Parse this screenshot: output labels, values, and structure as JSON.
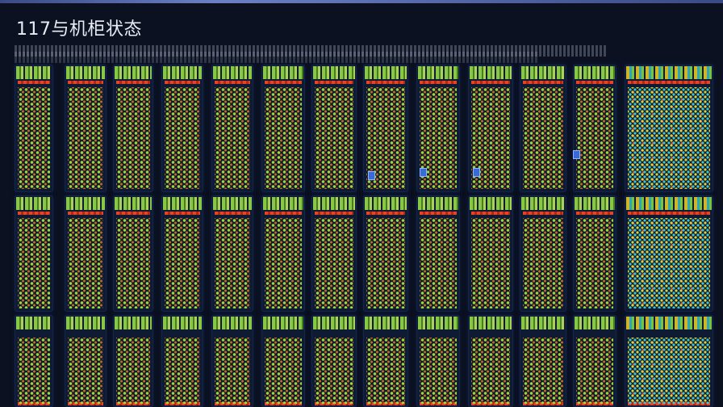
{
  "header": {
    "title": "117与机柜状态"
  },
  "grid": {
    "rows": 3,
    "columns": 14
  }
}
